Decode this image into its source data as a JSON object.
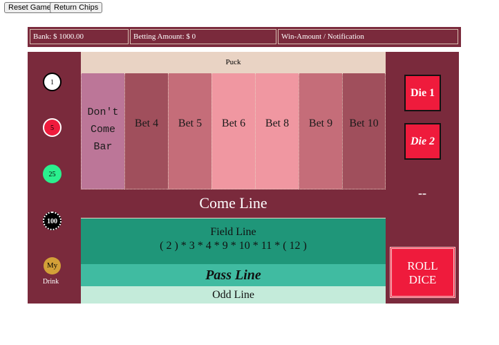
{
  "controls": {
    "reset_label": "Reset Game",
    "return_label": "Return Chips"
  },
  "status": {
    "bank": "Bank: $ 1000.00",
    "betting": "Betting Amount: $ 0",
    "notification": "Win-Amount / Notification"
  },
  "chips": [
    {
      "label": "1",
      "color": "#ffffff"
    },
    {
      "label": "5",
      "color": "#ef1b3c"
    },
    {
      "label": "25",
      "color": "#2bef8e"
    },
    {
      "label": "100",
      "color": "#000000"
    }
  ],
  "drink": {
    "label": "My",
    "caption": "Drink",
    "color": "#d3a038"
  },
  "table": {
    "puck": "Puck",
    "bets": [
      {
        "label": "Don't Come Bar",
        "color": "#bc7698"
      },
      {
        "label": "Bet 4",
        "color": "#a04f5c"
      },
      {
        "label": "Bet 5",
        "color": "#c56d79"
      },
      {
        "label": "Bet 6",
        "color": "#f097a1"
      },
      {
        "label": "Bet 8",
        "color": "#f097a1"
      },
      {
        "label": "Bet 9",
        "color": "#c56d79"
      },
      {
        "label": "Bet 10",
        "color": "#a04f5c"
      }
    ],
    "come_line": "Come Line",
    "field_line": "Field Line",
    "field_numbers": "( 2 ) * 3 * 4 * 9 * 10 * 11 * ( 12 )",
    "pass_line": "Pass Line",
    "odd_line": "Odd Line"
  },
  "dice": {
    "die1": "Die 1",
    "die2": "Die 2",
    "result": "--",
    "roll_line1": "ROLL",
    "roll_line2": "DICE"
  }
}
